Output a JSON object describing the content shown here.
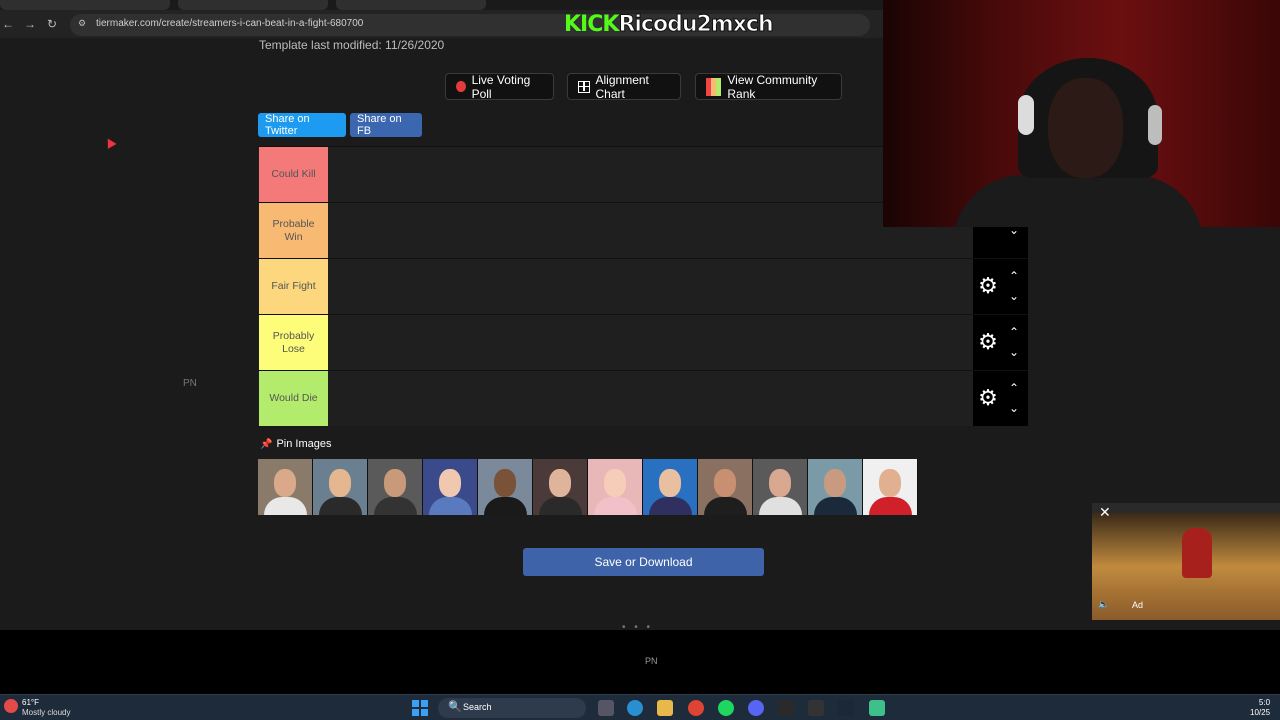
{
  "browser": {
    "url": "tiermaker.com/create/streamers-i-can-beat-in-a-fight-680700",
    "back_icon": "arrow-left-icon",
    "forward_icon": "arrow-right-icon",
    "reload_icon": "reload-icon"
  },
  "overlay": {
    "kick_prefix": "KICK",
    "username": "Ricodu2mxch"
  },
  "page": {
    "template_modified": "Template last modified: 11/26/2020",
    "buttons": {
      "live_voting": "Live Voting Poll",
      "alignment_chart": "Alignment Chart",
      "community_rank": "View Community Rank",
      "share_twitter": "Share on Twitter",
      "share_fb": "Share on FB",
      "save_download": "Save or Download"
    },
    "pin_images_label": "Pin Images",
    "pn_left": "PN",
    "pn_bottom": "PN",
    "dots": "• • •"
  },
  "tiers": [
    {
      "label": "Could Kill",
      "color": "#f47a7a"
    },
    {
      "label": "Probable Win",
      "color": "#f8b972"
    },
    {
      "label": "Fair Fight",
      "color": "#fcd77e"
    },
    {
      "label": "Probably Lose",
      "color": "#fdfd7a"
    },
    {
      "label": "Would Die",
      "color": "#b3ec6c"
    }
  ],
  "thumbnails": [
    {
      "face": "#d9a98a",
      "bg": "#8a7a6a",
      "shirt": "#e8e8e8"
    },
    {
      "face": "#e4b790",
      "bg": "#6a8090",
      "shirt": "#2a2a2a"
    },
    {
      "face": "#c99a7a",
      "bg": "#5a5a5a",
      "shirt": "#333333"
    },
    {
      "face": "#f0c8b0",
      "bg": "#3a4a8a",
      "shirt": "#5a7ac0"
    },
    {
      "face": "#7a5238",
      "bg": "#7a8a9a",
      "shirt": "#1a1a1a"
    },
    {
      "face": "#e0b49a",
      "bg": "#4a3a3a",
      "shirt": "#2a2a2a"
    },
    {
      "face": "#f5cdb8",
      "bg": "#e8b8b8",
      "shirt": "#f2c0c8"
    },
    {
      "face": "#e8c0a0",
      "bg": "#2a70c0",
      "shirt": "#303060"
    },
    {
      "face": "#c89070",
      "bg": "#8a7060",
      "shirt": "#1e1e1e"
    },
    {
      "face": "#d8a890",
      "bg": "#5a5a5a",
      "shirt": "#e0e0e0"
    },
    {
      "face": "#c89a80",
      "bg": "#7a9aa8",
      "shirt": "#1a2a3a"
    },
    {
      "face": "#e0b090",
      "bg": "#f0f0f0",
      "shirt": "#d0202a"
    }
  ],
  "ad": {
    "close_icon": "close-icon",
    "label": "Ad"
  },
  "taskbar": {
    "temperature": "61°F",
    "weather": "Mostly cloudy",
    "search_label": "Search",
    "clock": "5:0",
    "date": "10/25"
  }
}
